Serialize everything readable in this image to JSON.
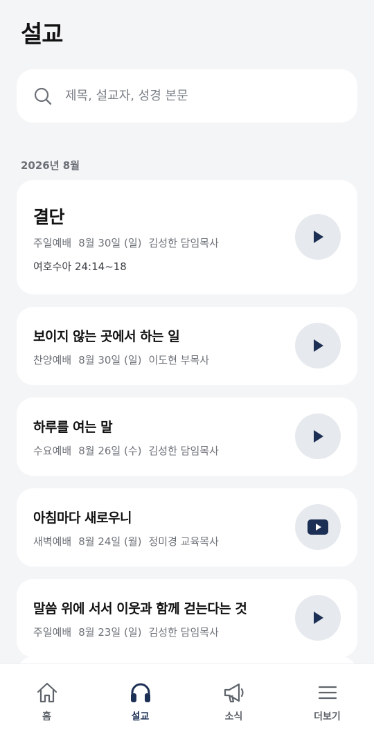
{
  "header": {
    "title": "설교"
  },
  "search": {
    "placeholder": "제목, 설교자, 성경 본문",
    "icon": "search-icon"
  },
  "month_label": "2026년 8월",
  "colors": {
    "accent": "#1c2f54",
    "button_bg": "#e6e9ed",
    "meta_text": "#6d7178"
  },
  "sermons": [
    {
      "title": "결단",
      "service": "주일예배",
      "date": "8월 30일 (일)",
      "preacher": "김성한 담임목사",
      "scripture": "여호수아 24:14~18",
      "action_icon": "play-icon"
    },
    {
      "title": "보이지 않는 곳에서 하는 일",
      "service": "찬양예배",
      "date": "8월 30일 (일)",
      "preacher": "이도현 부목사",
      "action_icon": "play-icon"
    },
    {
      "title": "하루를 여는 말",
      "service": "수요예배",
      "date": "8월 26일 (수)",
      "preacher": "김성한 담임목사",
      "action_icon": "play-icon"
    },
    {
      "title": "아침마다 새로우니",
      "service": "새벽예배",
      "date": "8월 24일 (월)",
      "preacher": "정미경 교육목사",
      "action_icon": "youtube-icon"
    },
    {
      "title": "말씀 위에 서서 이웃과 함께 걷는다는 것",
      "service": "주일예배",
      "date": "8월 23일 (일)",
      "preacher": "김성한 담임목사",
      "action_icon": "play-icon"
    }
  ],
  "nav": [
    {
      "label": "홈",
      "icon": "home-icon",
      "active": false
    },
    {
      "label": "설교",
      "icon": "headphones-icon",
      "active": true
    },
    {
      "label": "소식",
      "icon": "megaphone-icon",
      "active": false
    },
    {
      "label": "더보기",
      "icon": "menu-icon",
      "active": false
    }
  ]
}
